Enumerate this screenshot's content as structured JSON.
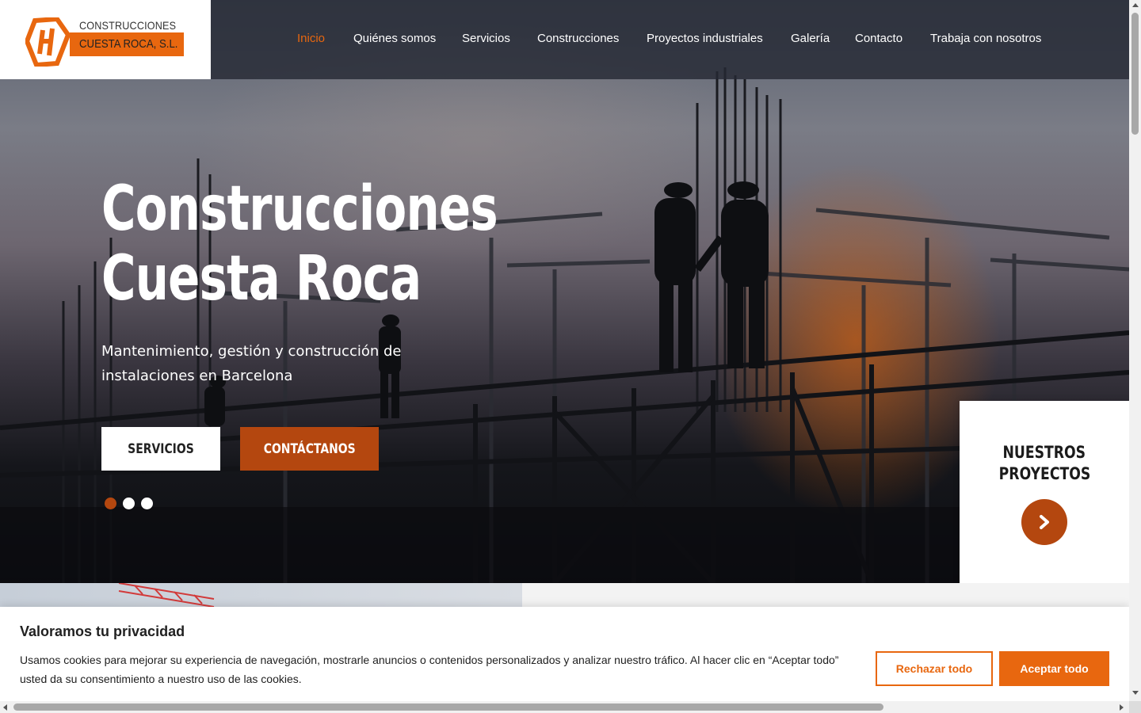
{
  "brand": {
    "logo_line1": "CONSTRUCCIONES",
    "logo_line2": "CUESTA ROCA, S.L.",
    "logo_icon": "ch-monogram-icon",
    "accent_color": "#e8670f",
    "dark_accent_color": "#b4470f"
  },
  "nav": {
    "items": [
      {
        "label": "Inicio",
        "active": true
      },
      {
        "label": "Quiénes somos",
        "active": false
      },
      {
        "label": "Servicios",
        "active": false
      },
      {
        "label": "Construcciones",
        "active": false
      },
      {
        "label": "Proyectos industriales",
        "active": false
      },
      {
        "label": "Galería",
        "active": false
      },
      {
        "label": "Contacto",
        "active": false
      },
      {
        "label": "Trabaja con nosotros",
        "active": false
      }
    ]
  },
  "hero": {
    "title_line1": "Construcciones",
    "title_line2": "Cuesta Roca",
    "subtitle": "Mantenimiento, gestión y construcción de instalaciones en Barcelona",
    "btn_services": "SERVICIOS",
    "btn_contact": "CONTÁCTANOS",
    "slides_total": 3,
    "slide_active": 1
  },
  "projects_card": {
    "title_line1": "NUESTROS",
    "title_line2": "PROYECTOS",
    "arrow_icon": "chevron-right-icon"
  },
  "cookie": {
    "title": "Valoramos tu privacidad",
    "text": "Usamos cookies para mejorar su experiencia de navegación, mostrarle anuncios o contenidos personalizados y analizar nuestro tráfico. Al hacer clic en “Aceptar todo” usted da su consentimiento a nuestro uso de las cookies.",
    "reject_label": "Rechazar todo",
    "accept_label": "Aceptar todo"
  }
}
